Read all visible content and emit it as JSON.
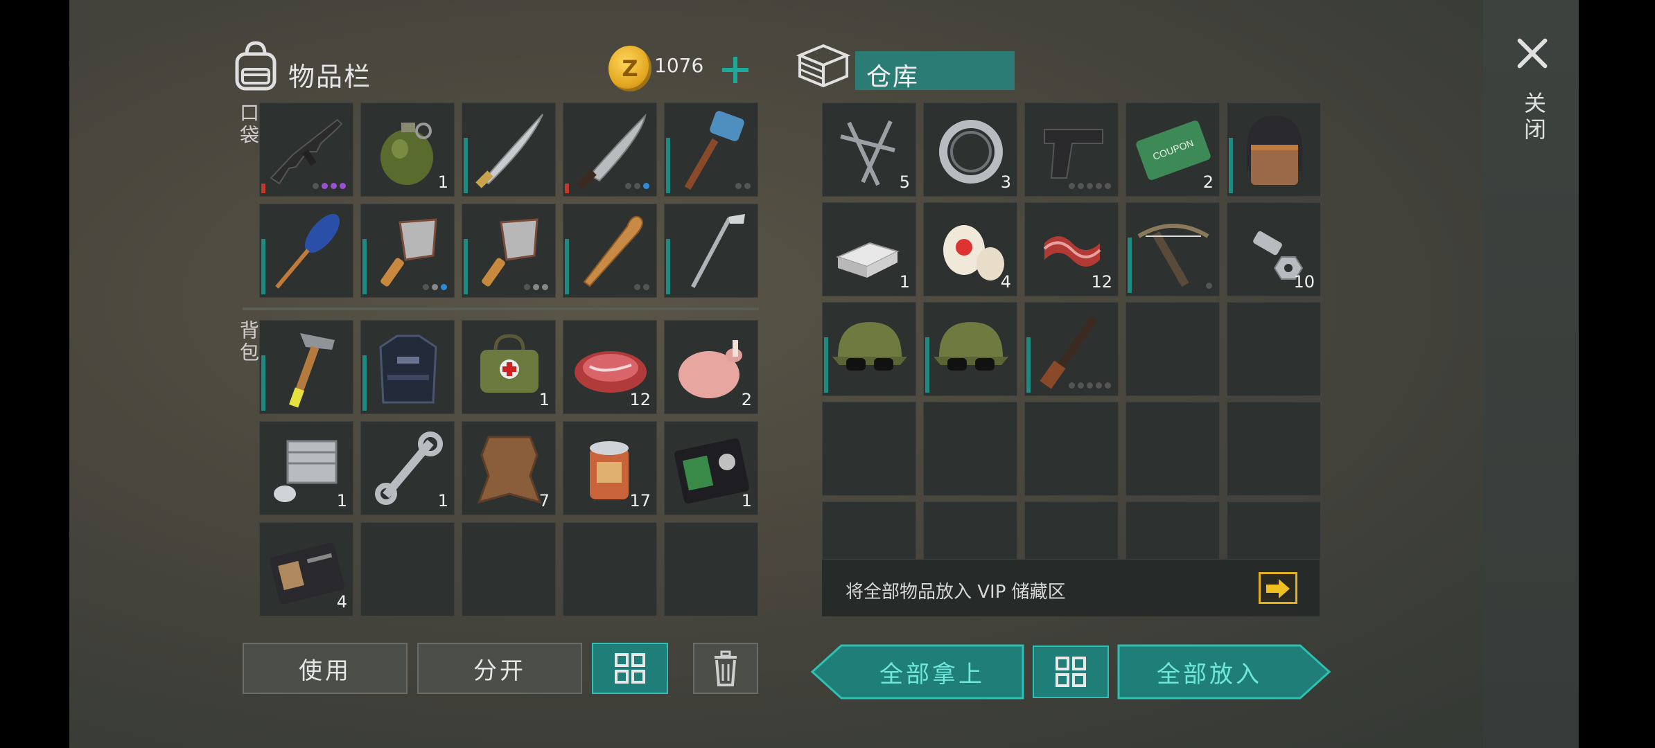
{
  "inventory": {
    "title": "物品栏",
    "coins": "1076",
    "pocket_label": "口袋",
    "backpack_label": "背包",
    "pocket": [
      {
        "icon": "assault-rifle-icon",
        "qty": "",
        "bar": "red"
      },
      {
        "icon": "grenade-icon",
        "qty": "1",
        "bar": ""
      },
      {
        "icon": "katana-icon",
        "qty": "",
        "bar": "teal"
      },
      {
        "icon": "machete-icon",
        "qty": "",
        "bar": "red"
      },
      {
        "icon": "sledgehammer-icon",
        "qty": "",
        "bar": "teal"
      },
      {
        "icon": "paddle-icon",
        "qty": "",
        "bar": "teal"
      },
      {
        "icon": "cleaver-icon",
        "qty": "",
        "bar": "teal"
      },
      {
        "icon": "cleaver-icon",
        "qty": "",
        "bar": "teal"
      },
      {
        "icon": "baseball-bat-icon",
        "qty": "",
        "bar": "teal"
      },
      {
        "icon": "golf-club-icon",
        "qty": "",
        "bar": "teal"
      }
    ],
    "backpack": [
      {
        "icon": "claw-hammer-icon",
        "qty": "",
        "bar": "teal"
      },
      {
        "icon": "body-armor-icon",
        "qty": "",
        "bar": "teal"
      },
      {
        "icon": "first-aid-bag-icon",
        "qty": "1",
        "bar": ""
      },
      {
        "icon": "raw-meat-icon",
        "qty": "12",
        "bar": ""
      },
      {
        "icon": "raw-chicken-icon",
        "qty": "2",
        "bar": ""
      },
      {
        "icon": "engine-cylinder-icon",
        "qty": "1",
        "bar": ""
      },
      {
        "icon": "wrench-icon",
        "qty": "1",
        "bar": ""
      },
      {
        "icon": "animal-hide-icon",
        "qty": "7",
        "bar": ""
      },
      {
        "icon": "canned-food-icon",
        "qty": "17",
        "bar": ""
      },
      {
        "icon": "police-badge-wallet-icon",
        "qty": "1",
        "bar": ""
      },
      {
        "icon": "officer-id-card-icon",
        "qty": "4",
        "bar": ""
      }
    ],
    "buttons": {
      "use": "使用",
      "split": "分开"
    }
  },
  "storage": {
    "title": "仓库",
    "items": [
      {
        "icon": "nails-icon",
        "qty": "5",
        "bar": ""
      },
      {
        "icon": "bearing-ring-icon",
        "qty": "3",
        "bar": ""
      },
      {
        "icon": "pistol-icon",
        "qty": "",
        "bar": ""
      },
      {
        "icon": "ration-coupon-icon",
        "qty": "2",
        "bar": ""
      },
      {
        "icon": "riot-helmet-icon",
        "qty": "",
        "bar": "teal"
      },
      {
        "icon": "metal-ingots-icon",
        "qty": "1",
        "bar": ""
      },
      {
        "icon": "bandage-icon",
        "qty": "4",
        "bar": ""
      },
      {
        "icon": "raw-bacon-icon",
        "qty": "12",
        "bar": ""
      },
      {
        "icon": "crossbow-icon",
        "qty": "",
        "bar": "teal"
      },
      {
        "icon": "bolts-nuts-icon",
        "qty": "10",
        "bar": ""
      },
      {
        "icon": "camo-cap-sunglasses-icon",
        "qty": "",
        "bar": "teal"
      },
      {
        "icon": "camo-cap-sunglasses-icon",
        "qty": "",
        "bar": "teal"
      },
      {
        "icon": "shotgun-icon",
        "qty": "",
        "bar": "teal"
      }
    ],
    "vip_text": "将全部物品放入 VIP 储藏区",
    "buttons": {
      "take_all": "全部拿上",
      "put_all": "全部放入"
    }
  },
  "close_label": "关闭",
  "colors": {
    "teal": "#1f7f78",
    "teal_bright": "#2ec1b3",
    "durability_teal": "#1f8a82",
    "durability_red": "#c23b2a",
    "coin_gold": "#e2a520"
  }
}
